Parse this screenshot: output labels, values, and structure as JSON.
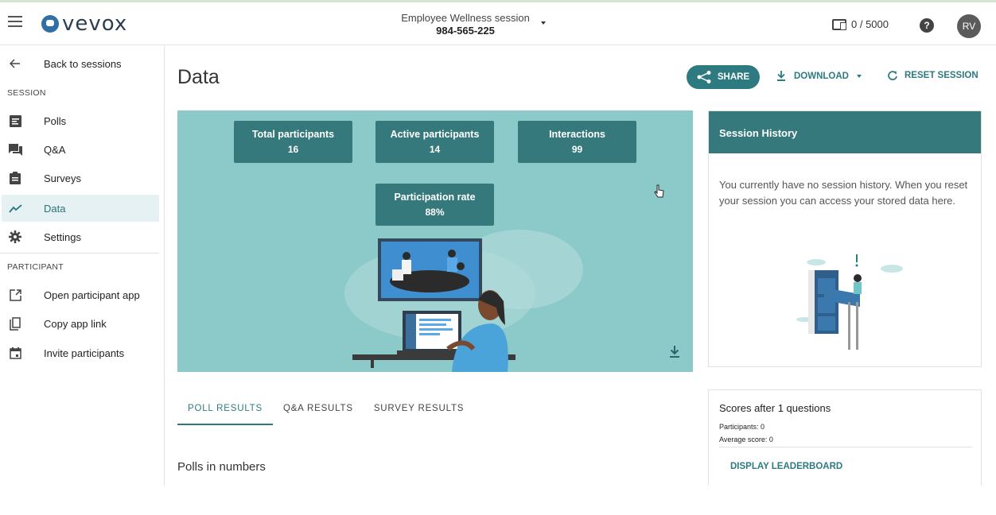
{
  "header": {
    "app_name": "vevox",
    "session_name": "Employee Wellness session",
    "session_code": "984-565-225",
    "participants": "0 / 5000",
    "help": "?",
    "avatar": "RV"
  },
  "sidebar": {
    "back_label": "Back to sessions",
    "session_section": "SESSION",
    "session_items": [
      {
        "label": "Polls",
        "icon": "polls-icon"
      },
      {
        "label": "Q&A",
        "icon": "qa-icon"
      },
      {
        "label": "Surveys",
        "icon": "surveys-icon"
      },
      {
        "label": "Data",
        "icon": "data-icon",
        "active": true
      },
      {
        "label": "Settings",
        "icon": "gear-icon"
      }
    ],
    "participant_section": "PARTICIPANT",
    "participant_items": [
      {
        "label": "Open participant app",
        "icon": "external-link-icon"
      },
      {
        "label": "Copy app link",
        "icon": "copy-icon"
      },
      {
        "label": "Invite participants",
        "icon": "calendar-icon"
      }
    ]
  },
  "main": {
    "title": "Data",
    "share_label": "SHARE",
    "download_label": "DOWNLOAD",
    "reset_label": "RESET SESSION",
    "stats": [
      {
        "title": "Total participants",
        "value": "16"
      },
      {
        "title": "Active participants",
        "value": "14"
      },
      {
        "title": "Interactions",
        "value": "99"
      },
      {
        "title": "Participation rate",
        "value": "88%"
      }
    ],
    "tabs": [
      {
        "label": "POLL RESULTS",
        "active": true
      },
      {
        "label": "Q&A RESULTS",
        "active": false
      },
      {
        "label": "SURVEY RESULTS",
        "active": false
      }
    ],
    "polls_heading": "Polls in numbers"
  },
  "history": {
    "title": "Session History",
    "text": "You currently have no session history. When you reset your session you can access your stored data here."
  },
  "scores": {
    "title": "Scores after 1 questions",
    "participants": "Participants: 0",
    "average": "Average score: 0",
    "leaderboard_label": "DISPLAY LEADERBOARD"
  },
  "colors": {
    "accent": "#2d7b80",
    "hero_bg": "#8cc9c9",
    "stat_bg": "#36797c",
    "active_bg": "#e5f1f2"
  }
}
